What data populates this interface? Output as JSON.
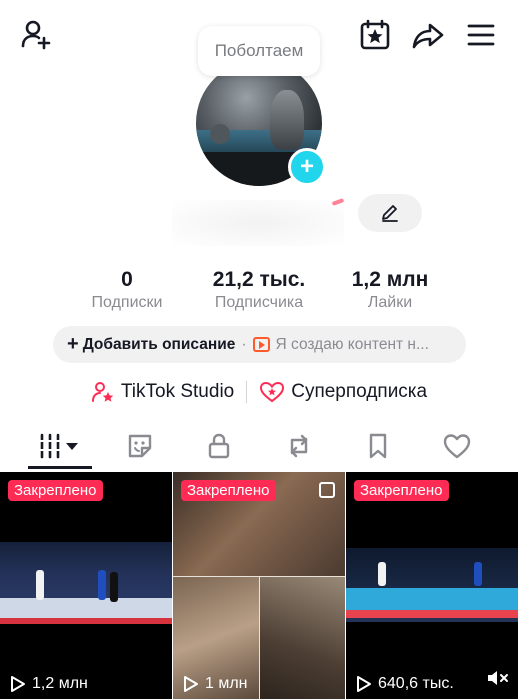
{
  "header": {
    "add_friend_icon": "person-plus-icon",
    "calendar_icon": "calendar-star-icon",
    "share_icon": "share-arrow-icon",
    "menu_icon": "hamburger-menu-icon"
  },
  "avatar": {
    "bubble_text": "Поболтаем",
    "add_icon": "+"
  },
  "stats": [
    {
      "value": "0",
      "label": "Подписки"
    },
    {
      "value": "21,2 тыс.",
      "label": "Подписчика"
    },
    {
      "value": "1,2 млн",
      "label": "Лайки"
    }
  ],
  "bio": {
    "plus": "+",
    "add_description": "Добавить описание",
    "separator": "·",
    "creator_text": "Я создаю контент н..."
  },
  "tools": {
    "studio": "TikTok Studio",
    "subscription": "Суперподписка"
  },
  "tabs": [
    "videos",
    "stickers",
    "private",
    "reposts",
    "favorites",
    "liked"
  ],
  "videos": [
    {
      "badge": "Закреплено",
      "views": "1,2 млн"
    },
    {
      "badge": "Закреплено",
      "views": "1 млн"
    },
    {
      "badge": "Закреплено",
      "views": "640,6 тыс."
    }
  ],
  "colors": {
    "accent": "#fe2c55",
    "avatar_add": "#20d5ec",
    "text": "#161823",
    "muted": "#8a8b91"
  }
}
